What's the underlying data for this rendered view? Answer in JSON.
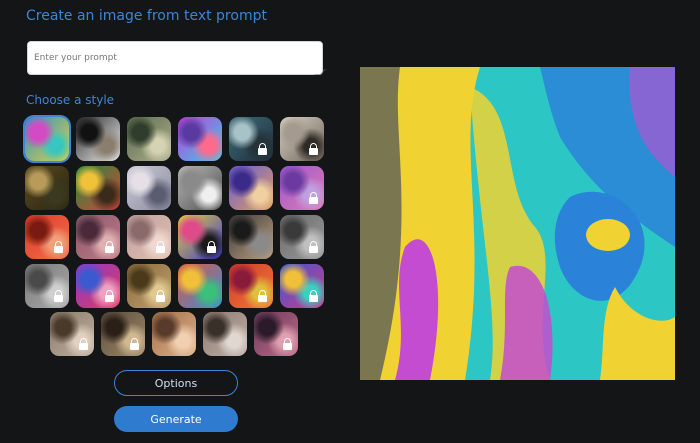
{
  "header": {
    "title": "Create an image from text prompt"
  },
  "prompt": {
    "placeholder": "Enter your prompt",
    "value": ""
  },
  "styles": {
    "heading": "Choose a style",
    "selected_index": 0,
    "tiles": [
      {
        "name": "style-abstract-paint",
        "locked": false,
        "colors": [
          "#2a8fd0",
          "#e7d23a",
          "#d44ac4",
          "#38c7c0"
        ]
      },
      {
        "name": "style-panda",
        "locked": false,
        "colors": [
          "#2a2a2a",
          "#f2f2f2",
          "#111111",
          "#8a7e6e"
        ]
      },
      {
        "name": "style-landscape",
        "locked": false,
        "colors": [
          "#5a6b4f",
          "#aeb08c",
          "#2f3d2b",
          "#d6d3b5"
        ]
      },
      {
        "name": "style-robot",
        "locked": false,
        "colors": [
          "#c23ad9",
          "#3ad0e8",
          "#5a3aa0",
          "#ff6a8c"
        ]
      },
      {
        "name": "style-portrait-woman",
        "locked": true,
        "colors": [
          "#3f6d7a",
          "#1e2c3a",
          "#a8c3c8",
          "#253238"
        ]
      },
      {
        "name": "style-vintage-photo",
        "locked": true,
        "colors": [
          "#d9d2c3",
          "#6e655a",
          "#a49b8e",
          "#2e2a25"
        ]
      },
      {
        "name": "style-mona-lisa",
        "locked": false,
        "colors": [
          "#5a4a22",
          "#2a2410",
          "#b89b5a",
          "#3a3a1e"
        ]
      },
      {
        "name": "style-flowers",
        "locked": false,
        "colors": [
          "#1b8b3a",
          "#d8453a",
          "#f0c23a",
          "#3a2a1a"
        ]
      },
      {
        "name": "style-ballet",
        "locked": false,
        "colors": [
          "#c9c9d6",
          "#8a8ca0",
          "#e6e0e6",
          "#5a5c70"
        ]
      },
      {
        "name": "style-sketch-machine",
        "locked": false,
        "colors": [
          "#bdbdbd",
          "#4a4a4a",
          "#8a8a8a",
          "#efefef"
        ]
      },
      {
        "name": "style-3d-room",
        "locked": false,
        "colors": [
          "#6a5ad9",
          "#e0a05a",
          "#3a2a8a",
          "#f0d0a0"
        ]
      },
      {
        "name": "style-pastel-objects",
        "locked": true,
        "colors": [
          "#9b5ad0",
          "#e07ab0",
          "#6a3aa0",
          "#c0a0e0"
        ]
      },
      {
        "name": "style-red-portrait",
        "locked": true,
        "colors": [
          "#e03a2a",
          "#f0704a",
          "#7a1a10",
          "#f0a07a"
        ]
      },
      {
        "name": "style-blur-portrait",
        "locked": true,
        "colors": [
          "#8a5a6a",
          "#c07a8a",
          "#4a2a3a",
          "#e0b0b0"
        ]
      },
      {
        "name": "style-soft-portrait",
        "locked": true,
        "colors": [
          "#c0a0a0",
          "#e0c0b0",
          "#8a6a6a",
          "#f0d8d0"
        ]
      },
      {
        "name": "style-pop-art",
        "locked": true,
        "colors": [
          "#e8d03a",
          "#3a3ad0",
          "#e04a8a",
          "#1a1a1a"
        ]
      },
      {
        "name": "style-architecture",
        "locked": false,
        "colors": [
          "#3a3a3a",
          "#c0a080",
          "#1a1a1a",
          "#8a8a8a"
        ]
      },
      {
        "name": "style-blur-photo",
        "locked": true,
        "colors": [
          "#6a6a6a",
          "#9a9a9a",
          "#3a3a3a",
          "#c0c0c0"
        ]
      },
      {
        "name": "style-mosaic-gray",
        "locked": true,
        "colors": [
          "#7a7a7a",
          "#aaaaaa",
          "#4a4a4a",
          "#cfcfcf"
        ]
      },
      {
        "name": "style-purple-figure",
        "locked": true,
        "colors": [
          "#8a3ad0",
          "#e03a5a",
          "#3a5ad0",
          "#f0a0c0"
        ]
      },
      {
        "name": "style-earth-texture",
        "locked": true,
        "colors": [
          "#8a6a3a",
          "#c0a070",
          "#4a3a1a",
          "#e0c890"
        ]
      },
      {
        "name": "style-icons-grid",
        "locked": false,
        "colors": [
          "#e05a3a",
          "#3a8ae0",
          "#f0c03a",
          "#3ac07a"
        ]
      },
      {
        "name": "style-red-abstract",
        "locked": true,
        "colors": [
          "#d03a2a",
          "#f07a3a",
          "#8a1a3a",
          "#e0c03a"
        ]
      },
      {
        "name": "style-kaleido",
        "locked": true,
        "colors": [
          "#3a5ad0",
          "#d03a8a",
          "#f0c03a",
          "#3ad0c0"
        ]
      },
      {
        "name": "style-blur-face",
        "locked": true,
        "colors": [
          "#8a7a6a",
          "#c0b0a0",
          "#4a3a2a",
          "#e0d0c0"
        ]
      },
      {
        "name": "style-warrior",
        "locked": true,
        "colors": [
          "#5a4a3a",
          "#a08a6a",
          "#2a2018",
          "#d0b890"
        ]
      },
      {
        "name": "style-woman-portrait",
        "locked": false,
        "colors": [
          "#a0704a",
          "#e0b08a",
          "#5a3a2a",
          "#f0d0b0"
        ]
      },
      {
        "name": "style-hat-man",
        "locked": false,
        "colors": [
          "#8a7a70",
          "#c0b0a8",
          "#3a302a",
          "#e0d8d0"
        ]
      },
      {
        "name": "style-dark-portrait",
        "locked": true,
        "colors": [
          "#6a3a5a",
          "#c06a8a",
          "#2a1a2a",
          "#e0a0b0"
        ]
      }
    ]
  },
  "buttons": {
    "options": "Options",
    "generate": "Generate"
  },
  "result": {
    "alt": "Generated abstract painting",
    "colors": [
      "#2cc7c4",
      "#f0d232",
      "#c44cd0",
      "#2a83d8",
      "#1a2a6a"
    ]
  }
}
